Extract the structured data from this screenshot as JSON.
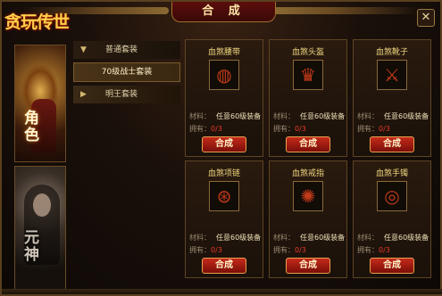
{
  "window": {
    "title": "合 成",
    "logo_text": "贪玩传世"
  },
  "close_symbol": "✕",
  "characters": [
    {
      "label": "角色"
    },
    {
      "label": "元神"
    }
  ],
  "categories": {
    "open_label": "普通套装",
    "selected_sub_label": "70级战士套装",
    "closed_label": "明王套装",
    "arrow_open": "▼",
    "arrow_closed": "▶"
  },
  "labels": {
    "material": "材料：",
    "owned": "拥有：",
    "craft_button": "合成"
  },
  "items": [
    {
      "name": "血煞腰带",
      "material": "任意60级装备",
      "owned": "0/3",
      "icon": "belt-icon",
      "glyph": "◍"
    },
    {
      "name": "血煞头盔",
      "material": "任意60级装备",
      "owned": "0/3",
      "icon": "helmet-icon",
      "glyph": "♛"
    },
    {
      "name": "血煞靴子",
      "material": "任意60级装备",
      "owned": "0/3",
      "icon": "boots-icon",
      "glyph": "⚔"
    },
    {
      "name": "血煞项链",
      "material": "任意60级装备",
      "owned": "0/3",
      "icon": "necklace-icon",
      "glyph": "⊛"
    },
    {
      "name": "血煞戒指",
      "material": "任意60级装备",
      "owned": "0/3",
      "icon": "ring-icon",
      "glyph": "✺"
    },
    {
      "name": "血煞手镯",
      "material": "任意60级装备",
      "owned": "0/3",
      "icon": "bracelet-icon",
      "glyph": "◎"
    }
  ],
  "colors": {
    "accent": "#c42a1a",
    "gold_text": "#f0d880",
    "count_red": "#e83828"
  }
}
